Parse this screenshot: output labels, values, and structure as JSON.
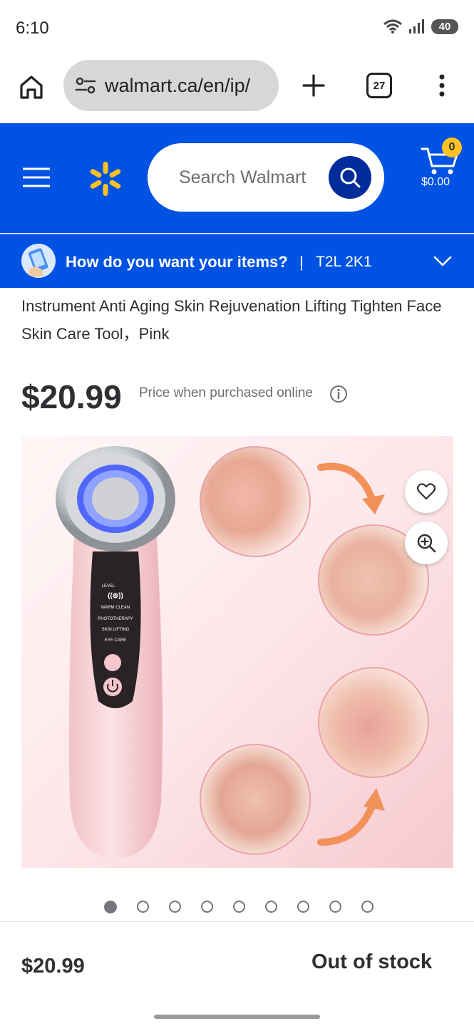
{
  "status_bar": {
    "time": "6:10",
    "battery": "40"
  },
  "browser": {
    "url": "walmart.ca/en/ip/",
    "tab_count": "27"
  },
  "header": {
    "search_placeholder": "Search Walmart",
    "cart_count": "0",
    "cart_total": "$0.00",
    "brand_color": "#0053e2",
    "spark_color": "#ffc220"
  },
  "fulfillment": {
    "question": "How do you want your items?",
    "divider": "|",
    "postal_code": "T2L 2K1"
  },
  "product": {
    "title": "Instrument Anti Aging Skin Rejuvenation Lifting Tighten Face Skin Care Tool，Pink",
    "price": "$20.99",
    "price_note": "Price when purchased online",
    "device_labels": [
      "LEVEL",
      "WARM CLEAN",
      "PHOTOTHERAPY",
      "SKIN LIFTING",
      "EYE CARE"
    ],
    "image_count": 9,
    "active_image": 1
  },
  "bottom_bar": {
    "price": "$20.99",
    "stock_status": "Out of stock"
  }
}
